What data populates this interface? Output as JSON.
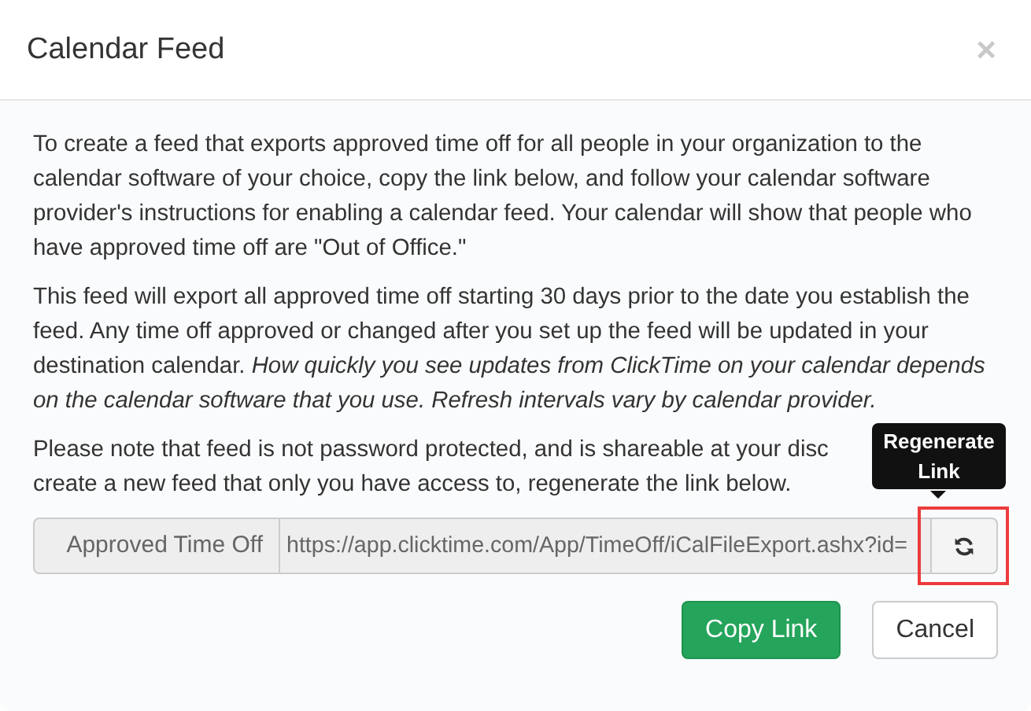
{
  "dialog": {
    "title": "Calendar Feed",
    "close": "×"
  },
  "paragraphs": [
    {
      "text": "To create a feed that exports approved time off for all people in your organization to the calendar software of your choice, copy the link below, and follow your calendar software provider's instructions for enabling a calendar feed. Your calendar will show that people who have approved time off are \"Out of Office.\""
    },
    {
      "text": "This feed will export all approved time off starting 30 days prior to the date you establish the feed. Any time off approved or changed after you set up the feed will be updated in your destination calendar. *How quickly you see updates from ClickTime on your calendar depends on the calendar software that you use. Refresh intervals vary by calendar provider.*"
    }
  ],
  "note_lines": [
    "Please note that feed is not password protected, and is shareable at your disc",
    "create a new feed that only you have access to, regenerate the link below."
  ],
  "feed": {
    "label": "Approved Time Off",
    "value": "https://app.clicktime.com/App/TimeOff/iCalFileExport.ashx?id=",
    "highlighted": true
  },
  "tooltip": "Regenerate Link",
  "buttons": [
    {
      "label": "Copy Link",
      "kind": "primary"
    },
    {
      "label": "Cancel",
      "kind": "default"
    }
  ]
}
